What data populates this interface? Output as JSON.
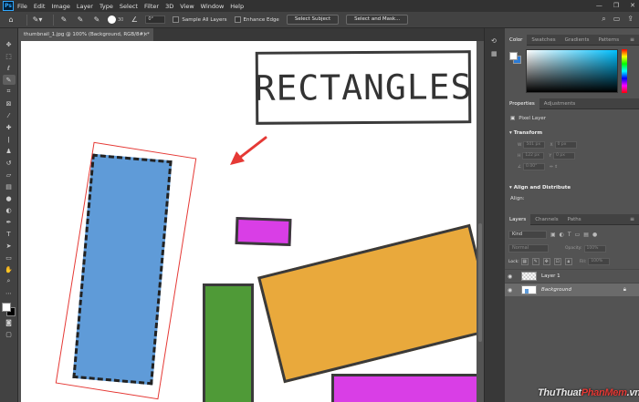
{
  "app": {
    "logo": "Ps"
  },
  "menu": [
    "File",
    "Edit",
    "Image",
    "Layer",
    "Type",
    "Select",
    "Filter",
    "3D",
    "View",
    "Window",
    "Help"
  ],
  "window_controls": {
    "minimize": "—",
    "maximize": "❐",
    "close": "✕"
  },
  "options_bar": {
    "brush_size": "30",
    "angle": "0°",
    "sample_all_layers": "Sample All Layers",
    "enhance_edge": "Enhance Edge",
    "select_subject": "Select Subject",
    "select_and_mask": "Select and Mask..."
  },
  "document": {
    "tab_title": "thumbnail_1.jpg @ 100% (Background, RGB/8#) *",
    "close": "×"
  },
  "canvas": {
    "title_text": "RECTANGLES"
  },
  "color_panel": {
    "tabs": [
      "Color",
      "Swatches",
      "Gradients",
      "Patterns"
    ]
  },
  "properties_panel": {
    "tabs": [
      "Properties",
      "Adjustments"
    ],
    "layer_type": "Pixel Layer",
    "transform_heading": "Transform",
    "w_label": "W",
    "w_value": "501 px",
    "h_label": "H",
    "h_value": "122 px",
    "x_label": "X",
    "x_value": "0 px",
    "y_label": "Y",
    "y_value": "0 px",
    "angle_value": "0.00°",
    "align_heading": "Align and Distribute",
    "align_label": "Align:"
  },
  "layers_panel": {
    "tabs": [
      "Layers",
      "Channels",
      "Paths"
    ],
    "kind": "Kind",
    "blend_mode": "Normal",
    "opacity_label": "Opacity:",
    "opacity_value": "100%",
    "lock_label": "Lock:",
    "fill_label": "Fill:",
    "fill_value": "100%",
    "layers": [
      {
        "name": "Layer 1"
      },
      {
        "name": "Background"
      }
    ]
  },
  "watermark": {
    "part1": "ThuThuat",
    "part2": "PhanMem",
    "part3": ".vn"
  },
  "colors": {
    "accent": "#31a8ff",
    "selection": "#e53935",
    "blue": "#5f9bd8",
    "magenta": "#d93ee6",
    "green": "#4f9a37",
    "orange": "#e9a93c"
  }
}
